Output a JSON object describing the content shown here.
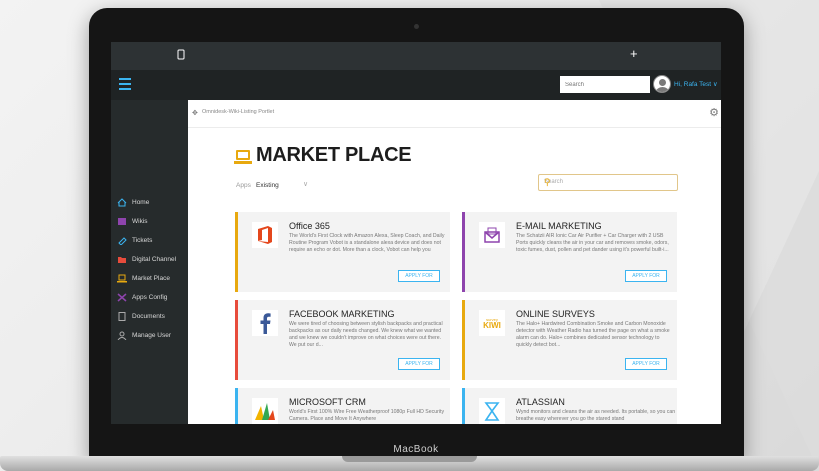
{
  "laptop_label": "MacBook",
  "topbar": {
    "left_icon": "tablet-icon",
    "plus": "+"
  },
  "header": {
    "search_placeholder": "Search",
    "user_name": "Hi, Rafa Test ∨"
  },
  "sidebar": {
    "items": [
      {
        "label": "Home",
        "icon": "home-icon",
        "color": "#3bb4f0"
      },
      {
        "label": "Wikis",
        "icon": "wiki-icon",
        "color": "#8e44ad"
      },
      {
        "label": "Tickets",
        "icon": "ticket-icon",
        "color": "#3bb4f0"
      },
      {
        "label": "Digital Channel",
        "icon": "folder-icon",
        "color": "#e74c3c"
      },
      {
        "label": "Market Place",
        "icon": "laptop-icon",
        "color": "#e8a90f"
      },
      {
        "label": "Apps Config",
        "icon": "tools-icon",
        "color": "#8e44ad"
      },
      {
        "label": "Documents",
        "icon": "document-icon",
        "color": "#aaaaaa"
      },
      {
        "label": "Manage User",
        "icon": "user-icon",
        "color": "#aaaaaa"
      }
    ]
  },
  "portlet": {
    "title": "Omnidesk-Wiki-Listing Portlet"
  },
  "marketplace": {
    "title": "MARKET PLACE",
    "apps_label": "Apps",
    "apps_value": "Existing",
    "search_placeholder": "Search",
    "apply_label": "APPLY FOR",
    "cards": [
      {
        "name": "Office 365",
        "desc": "The World's First Clock with Amazon Alexa, Sleep Coach, and Daily Routine Program Vobot is a standalone alexa device and does not require an echo or dot. More than a clock, Vobot can help you",
        "accent": "#e8a90f",
        "logo": "office-logo"
      },
      {
        "name": "E-MAIL MARKETING",
        "desc": "The Schatzii AIR Ionic Car Air Purifier + Car Charger with 2 USB Ports quickly cleans the air in your car and removes smoke, odors, toxic fumes, dust, pollen and pet dander using it's powerful built-i...",
        "accent": "#8e44ad",
        "logo": "email-logo"
      },
      {
        "name": "FACEBOOK MARKETING",
        "desc": "We were tired of choosing between stylish backpacks and practical backpacks as our daily needs changed. We knew what we wanted and we knew we couldn't improve on what choices were out there. We put our d...",
        "accent": "#e74c3c",
        "logo": "facebook-logo"
      },
      {
        "name": "ONLINE SURVEYS",
        "desc": "The Halo+ Hardwired Combination Smoke and Carbon Monoxide detector with Weather Radio has turned the page on what a smoke alarm can do. Halo+ combines dedicated sensor technology to quickly detect bot...",
        "accent": "#e8a90f",
        "logo": "kiwi-logo",
        "logo_text_top": "survey",
        "logo_text": "KIWI"
      },
      {
        "name": "MICROSOFT CRM",
        "desc": "World's First 100% Wire Free Weatherproof 1080p Full HD Security Camera. Place and Move It Anywhere",
        "accent": "#3bb4f0",
        "logo": "crm-logo"
      },
      {
        "name": "ATLASSIAN",
        "desc": "Wynd monitors and cleans the air as needed. Its portable, so you can breathe easy wherever you go the stared stand",
        "accent": "#3bb4f0",
        "logo": "atlassian-logo"
      }
    ]
  }
}
